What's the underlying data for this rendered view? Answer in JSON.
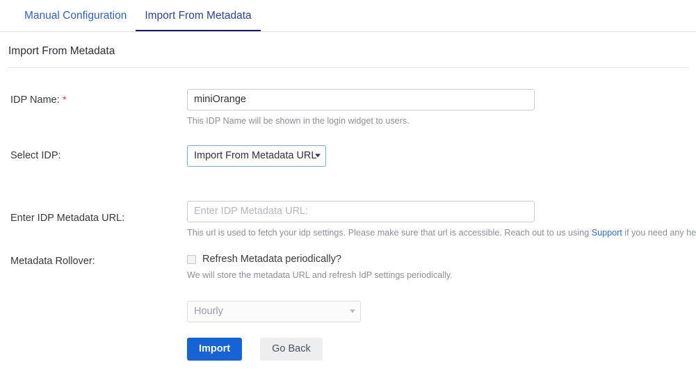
{
  "tabs": [
    {
      "label": "Manual Configuration",
      "active": false
    },
    {
      "label": "Import From Metadata",
      "active": true
    }
  ],
  "page": {
    "title": "Import From Metadata"
  },
  "form": {
    "idp_name": {
      "label": "IDP Name:",
      "required_marker": "*",
      "value": "miniOrange",
      "placeholder": "",
      "help": "This IDP Name will be shown in the login widget to users."
    },
    "select_idp": {
      "label": "Select IDP:",
      "selected": "Import From Metadata URL",
      "options": [
        "Import From Metadata URL"
      ]
    },
    "metadata_url": {
      "label": "Enter IDP Metadata URL:",
      "value": "",
      "placeholder": "Enter IDP Metadata URL:",
      "help_before": "This url is used to fetch your idp settings. Please make sure that url is accessible. Reach out to us using ",
      "help_link": "Support",
      "help_after": " if you need any help"
    },
    "metadata_rollover": {
      "label": "Metadata Rollover:",
      "checkbox_label": "Refresh Metadata periodically?",
      "checked": false,
      "help": "We will store the metadata URL and refresh IdP settings periodically.",
      "interval_selected": "Hourly",
      "interval_options": [
        "Hourly"
      ],
      "interval_disabled": true
    }
  },
  "actions": {
    "submit_label": "Import",
    "back_label": "Go Back"
  },
  "colors": {
    "tab_link": "#2f62c4",
    "tab_active_underline": "#14148c",
    "primary_button": "#1563d6",
    "secondary_button": "#eceef0",
    "link": "#3070d8",
    "required": "#e0342b"
  }
}
